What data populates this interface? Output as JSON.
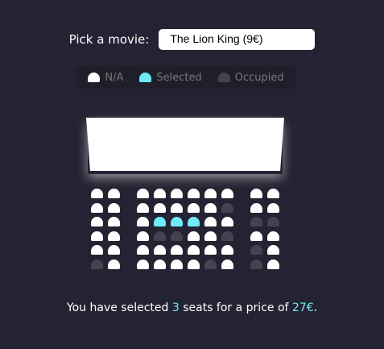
{
  "movie_picker": {
    "label": "Pick a movie:",
    "selected_movie": "The Lion King (9€)"
  },
  "legend": {
    "items": [
      {
        "label": "N/A",
        "status": "available"
      },
      {
        "label": "Selected",
        "status": "selected"
      },
      {
        "label": "Occupied",
        "status": "occupied"
      }
    ]
  },
  "seat_map": {
    "rows": [
      [
        "available",
        "available",
        "available",
        "available",
        "available",
        "available",
        "available",
        "available",
        "available",
        "available"
      ],
      [
        "available",
        "available",
        "available",
        "available",
        "available",
        "available",
        "available",
        "occupied",
        "available",
        "available"
      ],
      [
        "available",
        "available",
        "available",
        "selected",
        "selected",
        "selected",
        "available",
        "available",
        "occupied",
        "occupied"
      ],
      [
        "available",
        "available",
        "available",
        "occupied",
        "occupied",
        "available",
        "available",
        "occupied",
        "available",
        "available"
      ],
      [
        "available",
        "available",
        "available",
        "available",
        "available",
        "available",
        "available",
        "available",
        "occupied",
        "available"
      ],
      [
        "occupied",
        "available",
        "available",
        "available",
        "available",
        "available",
        "occupied",
        "available",
        "occupied",
        "available"
      ]
    ]
  },
  "summary": {
    "prefix": "You have selected ",
    "count": "3",
    "middle": " seats for a price of ",
    "total": "27€",
    "suffix": "."
  },
  "colors": {
    "background": "#242333",
    "available": "#ffffff",
    "selected": "#6feaf6",
    "occupied": "#444451"
  }
}
